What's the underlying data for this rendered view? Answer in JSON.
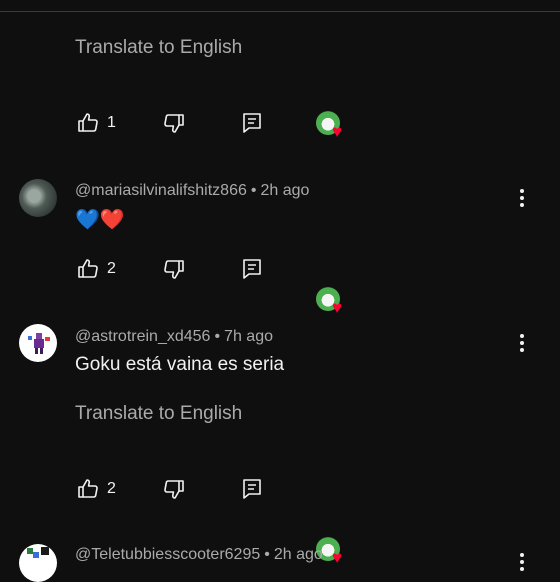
{
  "comments": [
    {
      "translate_label": "Translate to English",
      "likes": "1"
    },
    {
      "author": "@mariasilvinalifshitz866",
      "separator": "•",
      "time": "2h ago",
      "text": "💙❤️",
      "likes": "2"
    },
    {
      "author": "@astrotrein_xd456",
      "separator": "•",
      "time": "7h ago",
      "text": "Goku está vaina es seria",
      "translate_label": "Translate to English",
      "likes": "2"
    },
    {
      "author": "@Teletubbiesscooter6295",
      "separator": "•",
      "time": "2h ago"
    }
  ],
  "icons": {
    "like": "thumbs-up-icon",
    "dislike": "thumbs-down-icon",
    "reply": "reply-comment-icon",
    "creator_heart": "creator-heart-icon",
    "more": "more-vertical-icon"
  },
  "colors": {
    "background": "#0f0f0f",
    "text": "#f1f1f1",
    "secondary_text": "#aaaaaa",
    "heart": "#ff0033"
  }
}
